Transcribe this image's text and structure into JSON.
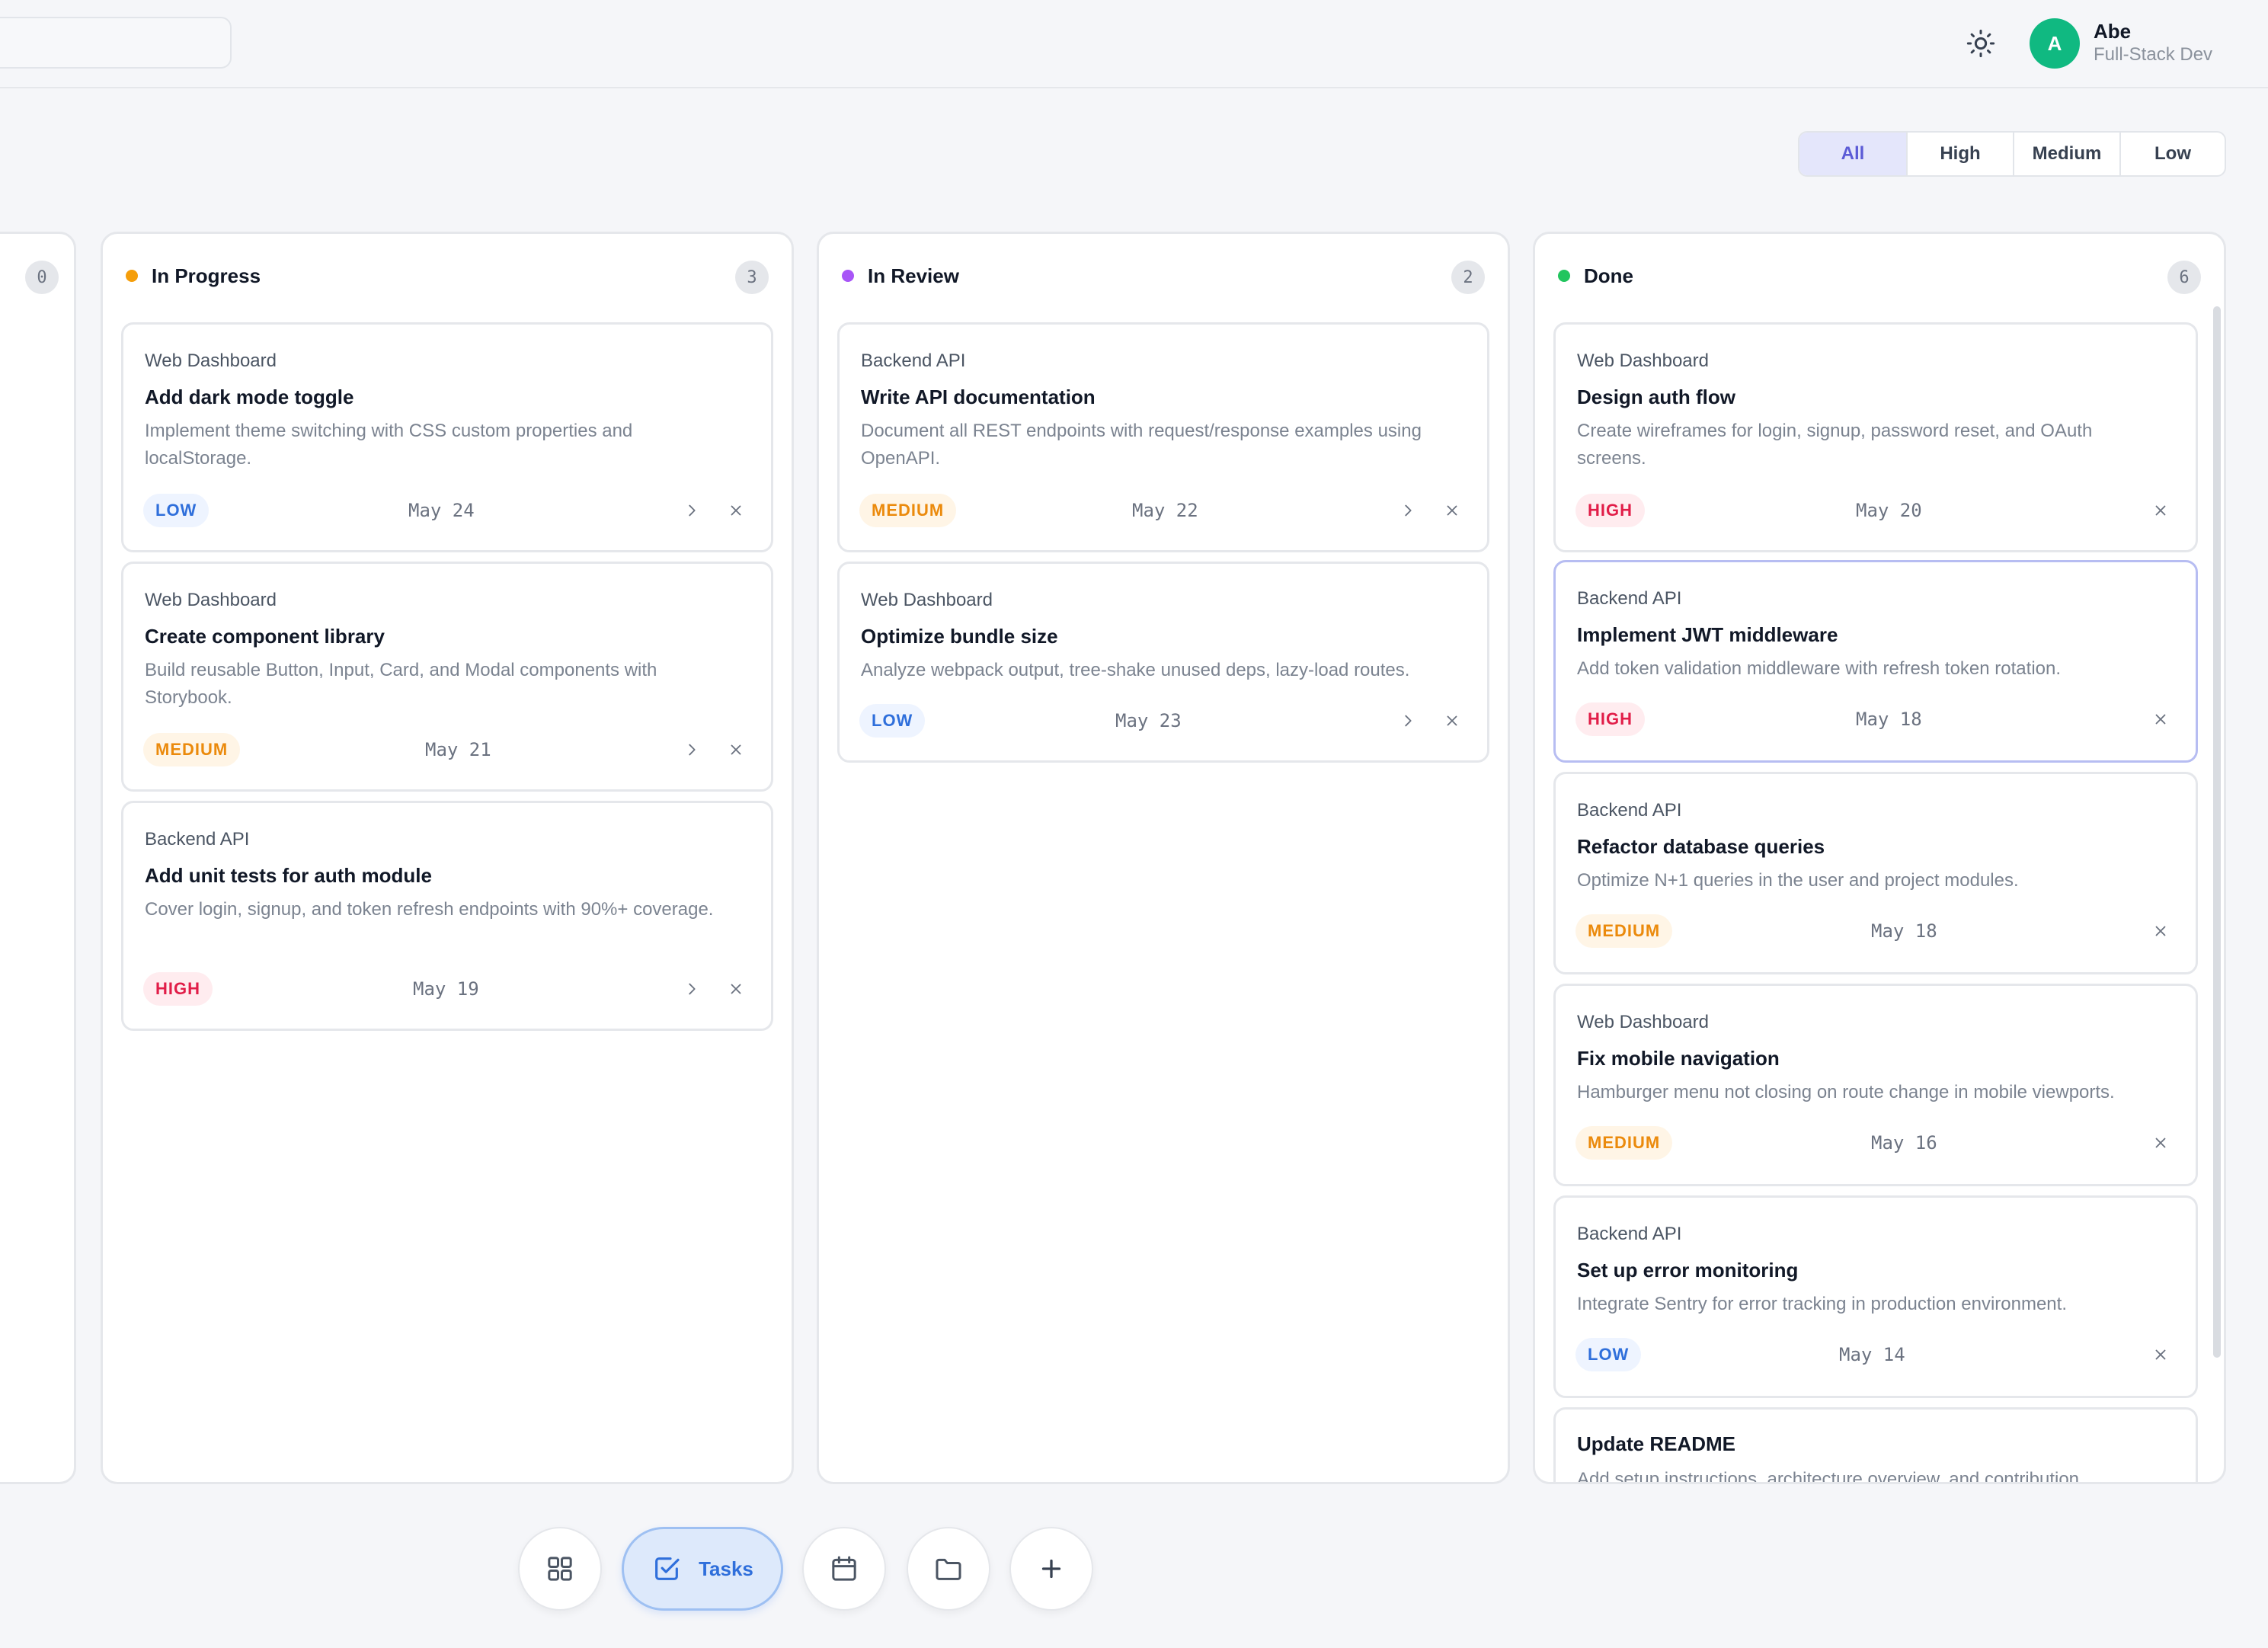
{
  "user": {
    "initial": "A",
    "name": "Abe",
    "role": "Full-Stack Dev"
  },
  "filter": {
    "options": [
      "All",
      "High",
      "Medium",
      "Low"
    ],
    "selected": "All"
  },
  "columns": [
    {
      "title": "",
      "count": "0"
    },
    {
      "title": "In Progress",
      "count": "3",
      "dot_color": "#f59e0b",
      "cards": [
        {
          "project": "Web Dashboard",
          "title": "Add dark mode toggle",
          "description": "Implement theme switching with CSS custom properties and localStorage.",
          "priority": "LOW",
          "date": "May 24"
        },
        {
          "project": "Web Dashboard",
          "title": "Create component library",
          "description": "Build reusable Button, Input, Card, and Modal components with Storybook.",
          "priority": "MEDIUM",
          "date": "May 21"
        },
        {
          "project": "Backend API",
          "title": "Add unit tests for auth module",
          "description": "Cover login, signup, and token refresh endpoints with 90%+ coverage.",
          "priority": "HIGH",
          "date": "May 19"
        }
      ]
    },
    {
      "title": "In Review",
      "count": "2",
      "dot_color": "#a855f7",
      "cards": [
        {
          "project": "Backend API",
          "title": "Write API documentation",
          "description": "Document all REST endpoints with request/response examples using OpenAPI.",
          "priority": "MEDIUM",
          "date": "May 22"
        },
        {
          "project": "Web Dashboard",
          "title": "Optimize bundle size",
          "description": "Analyze webpack output, tree-shake unused deps, lazy-load routes.",
          "priority": "LOW",
          "date": "May 23"
        }
      ]
    },
    {
      "title": "Done",
      "count": "6",
      "dot_color": "#22c55e",
      "cards": [
        {
          "project": "Web Dashboard",
          "title": "Design auth flow",
          "description": "Create wireframes for login, signup, password reset, and OAuth screens.",
          "priority": "HIGH",
          "date": "May 20"
        },
        {
          "project": "Backend API",
          "title": "Implement JWT middleware",
          "description": "Add token validation middleware with refresh token rotation.",
          "priority": "HIGH",
          "date": "May 18"
        },
        {
          "project": "Backend API",
          "title": "Refactor database queries",
          "description": "Optimize N+1 queries in the user and project modules.",
          "priority": "MEDIUM",
          "date": "May 18"
        },
        {
          "project": "Web Dashboard",
          "title": "Fix mobile navigation",
          "description": "Hamburger menu not closing on route change in mobile viewports.",
          "priority": "MEDIUM",
          "date": "May 16"
        },
        {
          "project": "Backend API",
          "title": "Set up error monitoring",
          "description": "Integrate Sentry for error tracking in production environment.",
          "priority": "LOW",
          "date": "May 14"
        },
        {
          "project": "",
          "title": "Update README",
          "description": "Add setup instructions, architecture overview, and contribution"
        }
      ]
    }
  ],
  "bottom_nav": {
    "tasks_label": "Tasks",
    "icons": [
      "grid-icon",
      "checkbox-icon",
      "calendar-icon",
      "folder-icon",
      "plus-icon"
    ]
  },
  "colors": {
    "accent": "#5b5bd6",
    "avatar": "#10b981",
    "tasks_blue": "#2f6fdb"
  }
}
